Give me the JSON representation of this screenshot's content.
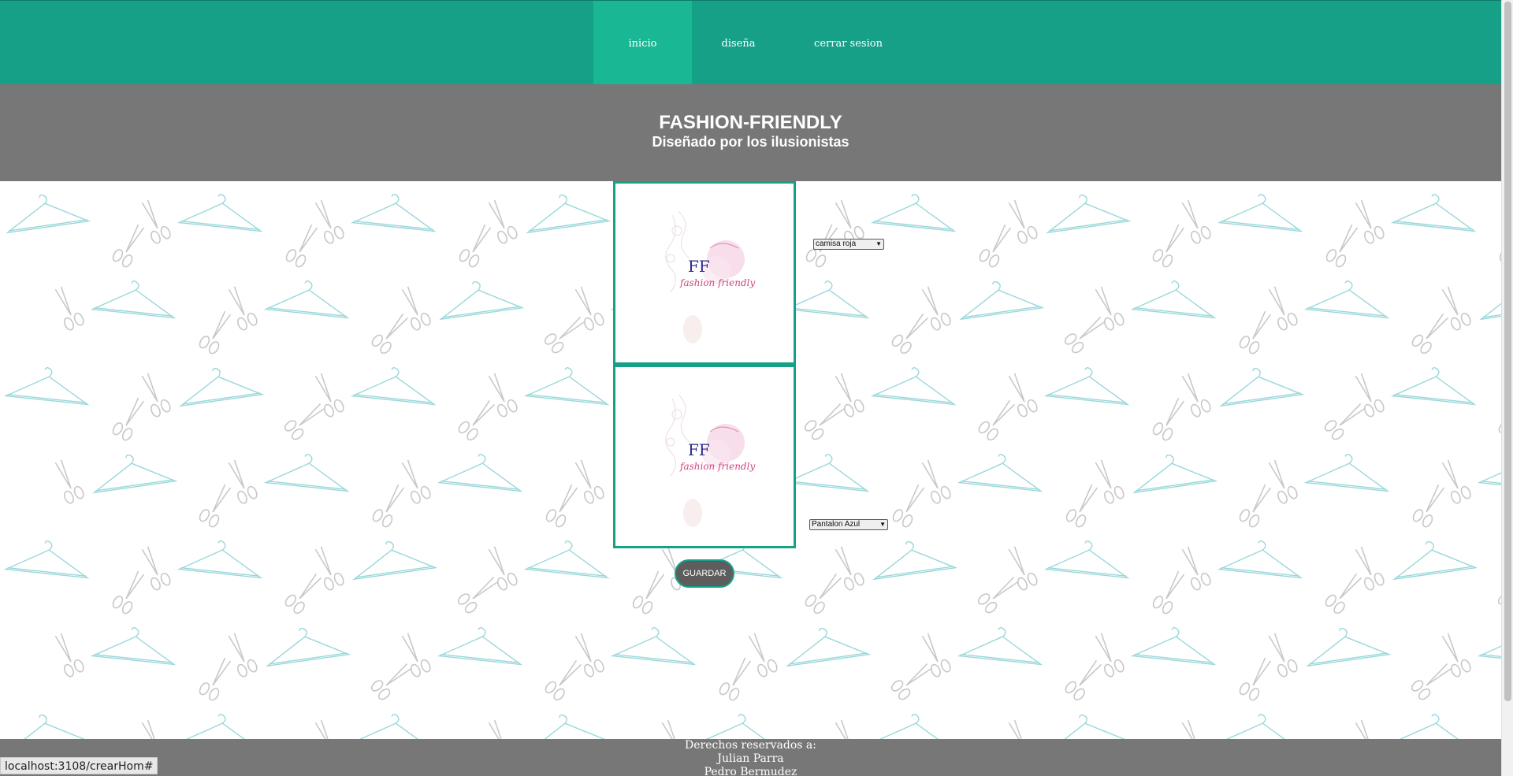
{
  "nav": {
    "items": [
      {
        "label": "inicio",
        "active": true
      },
      {
        "label": "diseña",
        "active": false
      },
      {
        "label": "cerrar sesion",
        "active": false
      }
    ]
  },
  "hero": {
    "title": "FASHION-FRIENDLY",
    "subtitle": "Diseñado por los ilusionistas"
  },
  "designer": {
    "top_select": {
      "selected": "camisa roja"
    },
    "bottom_select": {
      "selected": "Pantalon Azul"
    },
    "save_label": "GUARDAR",
    "logo_text": "FF",
    "logo_script": "fashion friendly"
  },
  "footer": {
    "rights": "Derechos reservados a:",
    "authors": [
      "Julian Parra",
      "Pedro Bermudez"
    ]
  },
  "status_bar": {
    "url": "localhost:3108/crearHom#"
  },
  "colors": {
    "nav_bg": "#17a088",
    "nav_active": "#1ab795",
    "band_gray": "#777777",
    "accent": "#17a088",
    "button_bg": "#5d5d5d"
  }
}
